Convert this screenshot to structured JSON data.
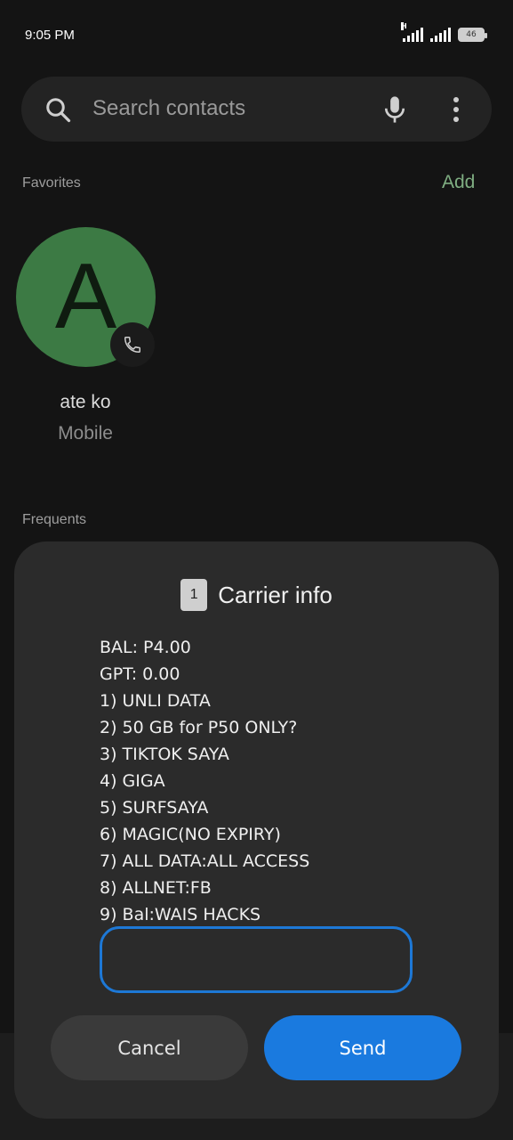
{
  "status_bar": {
    "time": "9:05 PM",
    "network_type": "H",
    "battery_level": "46",
    "battery_percent": 46
  },
  "search": {
    "placeholder": "Search contacts"
  },
  "favorites": {
    "label": "Favorites",
    "add_label": "Add",
    "contacts": [
      {
        "initial": "A",
        "name": "ate ko",
        "type": "Mobile",
        "avatar_color": "#3c7a44"
      }
    ]
  },
  "frequents": {
    "label": "Frequents"
  },
  "dialog": {
    "sim_slot": "1",
    "title": "Carrier info",
    "lines": [
      "BAL: P4.00",
      "GPT: 0.00",
      "1) UNLI DATA",
      "2) 50 GB for P50 ONLY?",
      "3) TIKTOK SAYA",
      "4) GIGA",
      "5) SURFSAYA",
      "6) MAGIC(NO EXPIRY)",
      "7) ALL DATA:ALL ACCESS",
      "8) ALLNET:FB",
      "9) Bal:WAIS HACKS"
    ],
    "reply_value": "",
    "cancel_label": "Cancel",
    "send_label": "Send"
  },
  "colors": {
    "background": "#141414",
    "accent_green": "#7fae82",
    "send_blue": "#1a7adf",
    "input_border": "#1d78d6"
  }
}
